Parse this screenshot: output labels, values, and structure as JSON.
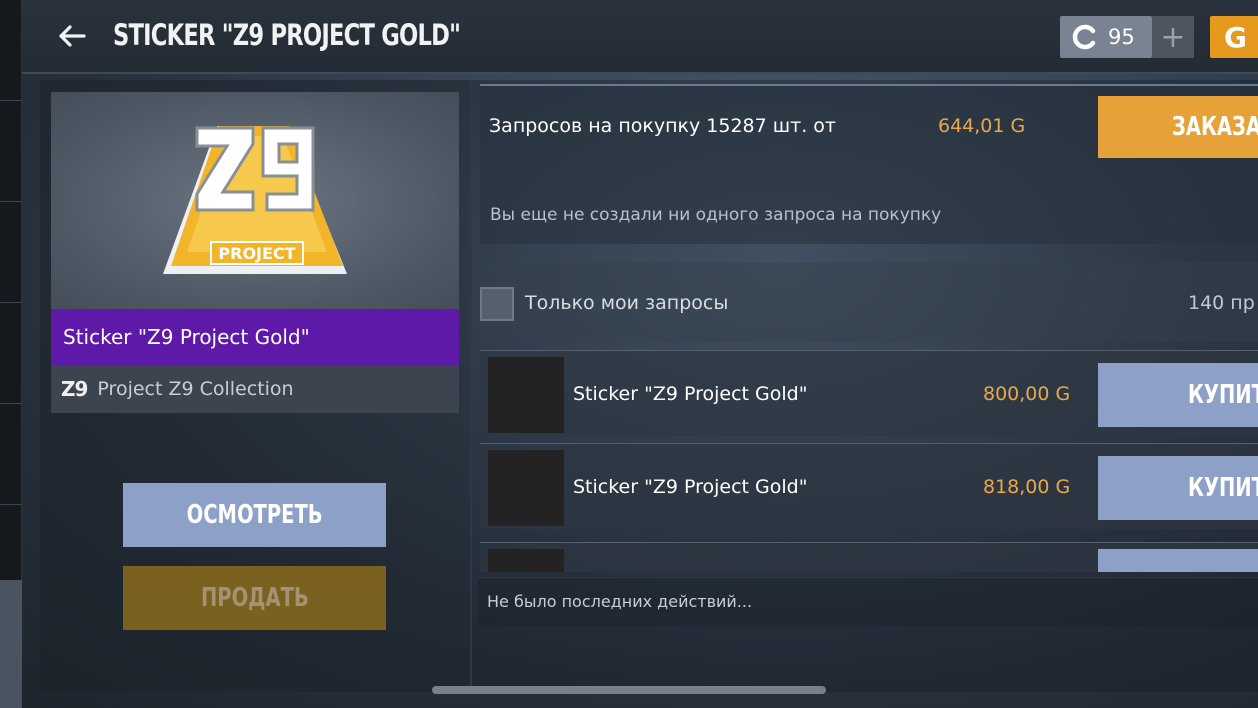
{
  "header": {
    "title": "STICKER \"Z9 PROJECT GOLD\"",
    "credits_value": "95",
    "plus_label": "+",
    "credits_icon": "C",
    "gold_icon": "G"
  },
  "item": {
    "name": "Sticker \"Z9 Project Gold\"",
    "collection_icon": "Z9",
    "collection": "Project Z9 Collection",
    "sticker_text": "PROJECT"
  },
  "actions": {
    "inspect_label": "ОСМОТРЕТЬ",
    "sell_label": "ПРОДАТЬ"
  },
  "requests": {
    "summary": "Запросов на покупку 15287 шт. от",
    "min_price": "644,01 G",
    "order_label": "ЗАКАЗА",
    "empty_message": "Вы еще не создали ни одного запроса на покупку"
  },
  "filter": {
    "label": "Только мои запросы",
    "count_text": "140 пр"
  },
  "listings": [
    {
      "name": "Sticker \"Z9 Project Gold\"",
      "price": "800,00 G",
      "buy_label": "КУПИТЬ"
    },
    {
      "name": "Sticker \"Z9 Project Gold\"",
      "price": "818,00 G",
      "buy_label": "КУПИТЬ"
    }
  ],
  "history": {
    "text": "Не было последних действий..."
  },
  "colors": {
    "rarity": "#5f19a8",
    "gold": "#e59a1e",
    "price": "#e9a94a",
    "button_blue": "#8da1c8"
  }
}
